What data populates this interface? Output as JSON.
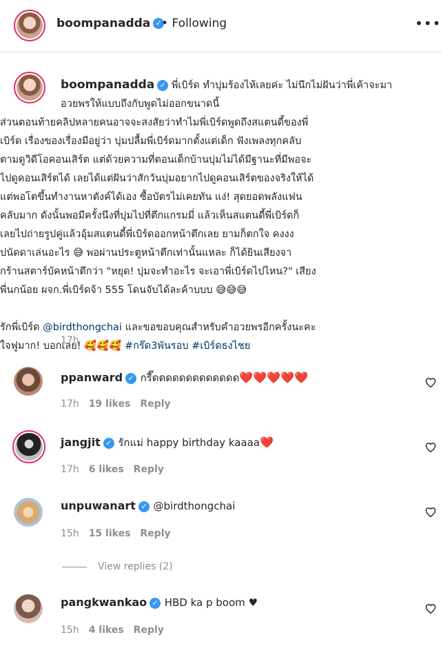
{
  "post": {
    "author": "boompanadda",
    "follow_dot": "•",
    "follow_status": "Following",
    "more_icon": "more-horizontal-icon"
  },
  "caption": {
    "author": "boompanadda",
    "lines": [
      "พี่เบิร์ด ทำบุ่มร้องไห้เลยค่ะ ไม่นึกไม่ฝันว่าพี่เค้าจะมา",
      "อวยพรให้แบบถึงกับพูดไม่ออกขนาดนี้",
      "ส่วนตอนท้ายคลิปหลายคนอาจจะสงสัยว่าทำไมพี่เบิร์ดพูดถึงสแตนดี้ของพี่",
      "เบิร์ด เรื่องของเรื่องมีอยู่ว่า บุ่มปลื้มพี่เบิร์ดมากตั้งแต่เด็ก ฟังเพลงทุกคลับ",
      "ตามดูวิดีโอคอนเสิร์ต แต่ด้วยความที่ตอนเด็กบ้านบุ่มไม่ได้มีฐานะที่มีพอจะ",
      "ไปดูคอนเสิร์ตได้ เลยได้แต่ฝันว่าสักวันบุ่มอยากไปดูคอนเสิร์ตของจริงให้ได้",
      "แต่พอโตขึ้นทำงานหาตังค์ได้เอง ซื้อบัตรไม่เคยทัน แง่! สุดยอดพลังแฟน",
      "คลับมาก ดังนั้นพอมีครั้งนึงที่บุ่มไปที่ตึกแกรมมี่ แล้วเห็นสแตนดี้พี่เบิร์ดก็",
      "เลยไปถ่ายรูปคู่แล้วอุ้มสแตนดี้พี่เบิร์ดออกหน้าตึกเลย ยามก็ตกใจ คงงง",
      "ปนัดดาเล่นอะไร 😅 พอผ่านประตูหน้าตึกเท่านั้นแหละ ก็ได้ยินเสียงจา",
      "กร้านสตาร์บัคหน้าตึกว่า \"หยุด! บุ่มจะทำอะไร จะเอาพี่เบิร์ดไปไหน?\" เสียง",
      "พี่นกน้อย ผจก.พี่เบิร์ดจ้า 555 โดนจับได้ละค้าบบบ 😅😅😅"
    ],
    "closing_pre": "รักพี่เบิร์ด ",
    "closing_mention": "@birdthongchai",
    "closing_post": " และขอขอบคุณสำหรับคำอวยพรอีกครั้งนะคะ",
    "closing_line2_pre": "ใจฟูมาก! บอกเลย! 🥰🥰🥰 ",
    "hashtag1": "#กร๊ด3พันรอบ",
    "hashtag2": "#เบิร์ดธงไชย",
    "time": "17h"
  },
  "comments": [
    {
      "user": "ppanward",
      "verified": true,
      "text": "กรี๊ดดดดดดดดดดดดด",
      "hearts": "❤️❤️❤️❤️❤️",
      "time": "17h",
      "likes": "19 likes",
      "reply": "Reply"
    },
    {
      "user": "jangjit",
      "verified": true,
      "text": "รักแม่ happy birthday kaaaa",
      "hearts": "❤️",
      "time": "17h",
      "likes": "6 likes",
      "reply": "Reply"
    },
    {
      "user": "unpuwanart",
      "verified": true,
      "text": "@birdthongchai",
      "hearts": "",
      "time": "15h",
      "likes": "15 likes",
      "reply": "Reply"
    },
    {
      "user": "pangkwankao",
      "verified": true,
      "text": "HBD ka p boom ♥",
      "hearts": "",
      "time": "15h",
      "likes": "4 likes",
      "reply": "Reply"
    }
  ],
  "view_replies": "View replies (2)",
  "colors": {
    "accent": "#3897f0",
    "link": "#00376b",
    "muted": "#8e8e8e",
    "heart": "#e0245e"
  }
}
